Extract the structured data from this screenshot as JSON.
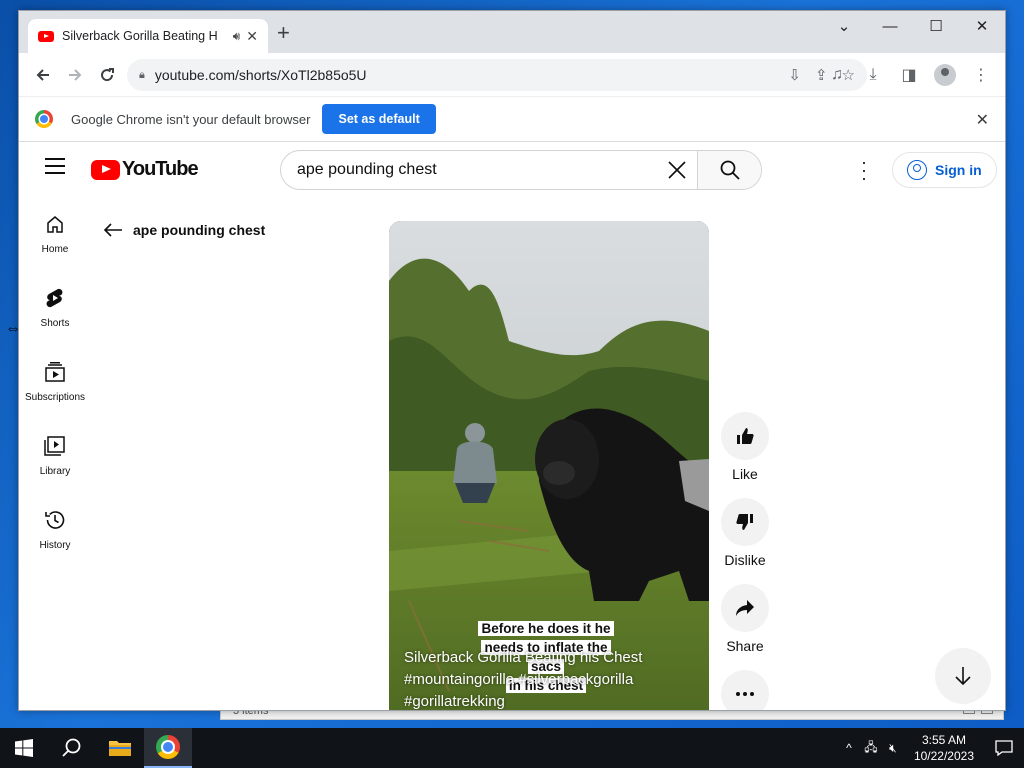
{
  "browser": {
    "tab_title": "Silverback Gorilla Beating H",
    "url": "youtube.com/shorts/XoTl2b85o5U",
    "infobar_text": "Google Chrome isn't your default browser",
    "infobar_button": "Set as default"
  },
  "youtube": {
    "logo_text": "YouTube",
    "search_query": "ape pounding chest",
    "signin_label": "Sign in",
    "back_label": "ape pounding chest",
    "guide": [
      {
        "label": "Home",
        "icon": "home-icon"
      },
      {
        "label": "Shorts",
        "icon": "shorts-icon"
      },
      {
        "label": "Subscriptions",
        "icon": "subscriptions-icon"
      },
      {
        "label": "Library",
        "icon": "library-icon"
      },
      {
        "label": "History",
        "icon": "history-icon"
      }
    ],
    "short": {
      "caption_lines": [
        "Before he does it he",
        "needs to inflate the sacs",
        "in his chest"
      ],
      "title": "Silverback Gorilla Beating his Chest #mountaingorilla #silverbackgorilla #gorillatrekking"
    },
    "actions": [
      {
        "label": "Like",
        "icon": "thumbs-up-icon"
      },
      {
        "label": "Dislike",
        "icon": "thumbs-down-icon"
      },
      {
        "label": "Share",
        "icon": "share-icon"
      },
      {
        "label": "",
        "icon": "more-icon"
      }
    ]
  },
  "behind_window": {
    "status_text": "3 items"
  },
  "taskbar": {
    "time": "3:55 AM",
    "date": "10/22/2023"
  },
  "colors": {
    "youtube_red": "#ff0000",
    "chrome_blue": "#1a73e8",
    "signin_blue": "#065fd4",
    "taskbar": "#101318"
  }
}
